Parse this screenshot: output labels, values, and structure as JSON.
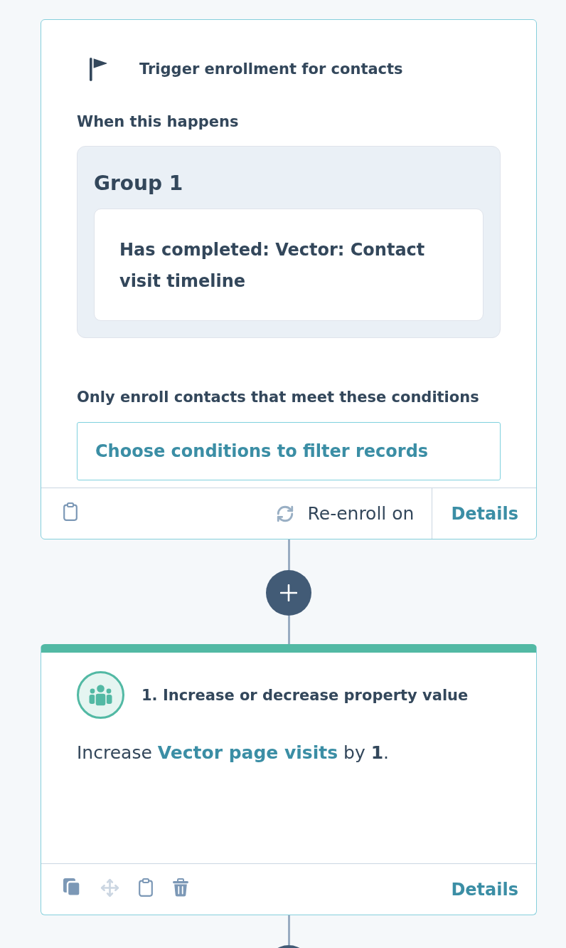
{
  "trigger": {
    "title": "Trigger enrollment for contacts",
    "trigger_label": "When this happens",
    "groups": [
      {
        "title": "Group 1",
        "criteria": [
          "Has completed: Vector: Contact visit timeline"
        ]
      }
    ],
    "filter_label": "Only enroll contacts that meet these conditions",
    "filter_button": "Choose conditions to filter records",
    "footer": {
      "reenroll_label": "Re-enroll on",
      "details_link": "Details"
    }
  },
  "actions": [
    {
      "title": "1. Increase or decrease property value",
      "description": [
        {
          "kind": "text",
          "text": "Increase "
        },
        {
          "kind": "link",
          "text": "Vector page visits"
        },
        {
          "kind": "text",
          "text": " by "
        },
        {
          "kind": "bold",
          "text": "1"
        },
        {
          "kind": "text",
          "text": "."
        }
      ],
      "tools": [
        {
          "kind": "copy",
          "disabled": false
        },
        {
          "kind": "move",
          "disabled": true
        },
        {
          "kind": "note",
          "disabled": false
        },
        {
          "kind": "delete",
          "disabled": false
        }
      ],
      "details_link": "Details"
    }
  ]
}
